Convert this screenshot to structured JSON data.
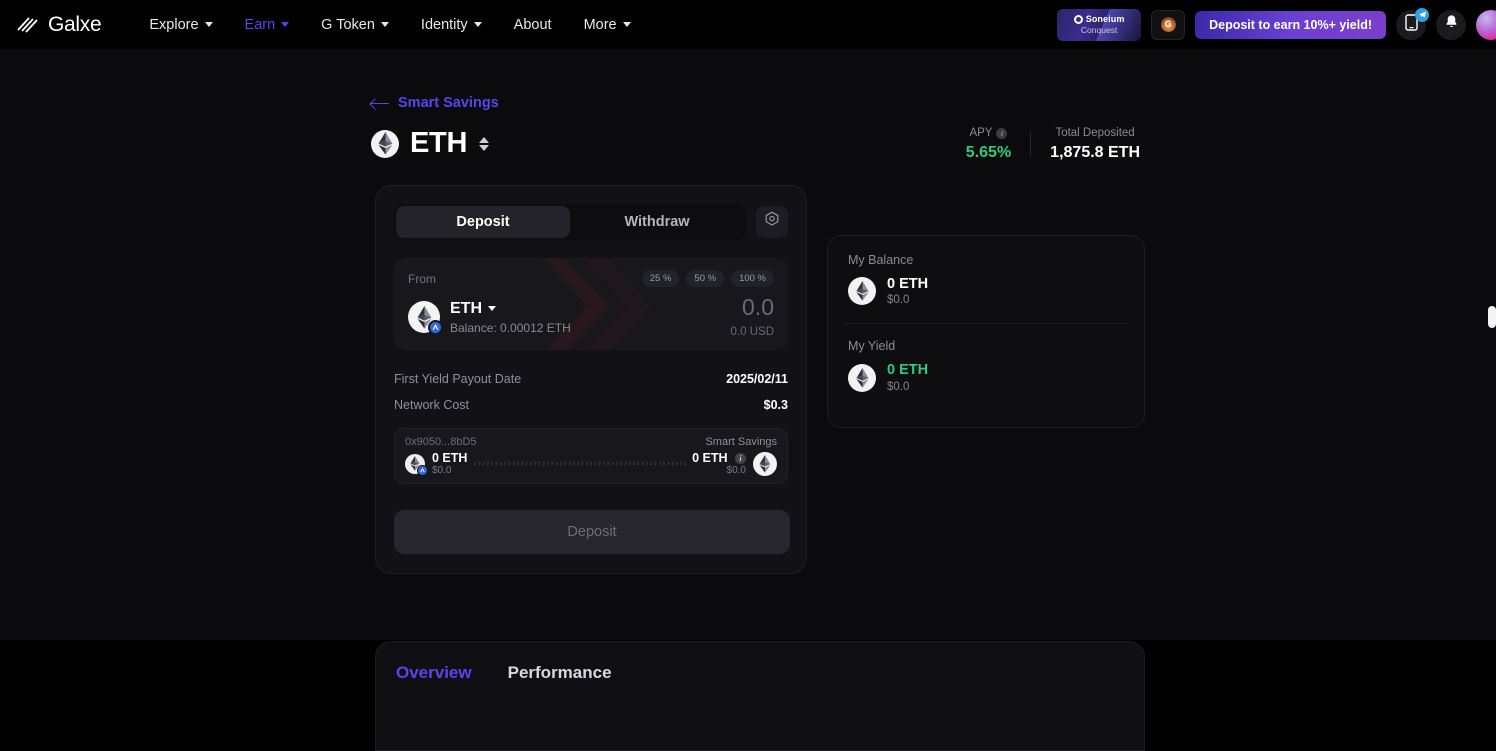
{
  "header": {
    "logo_text": "Galxe",
    "logo_icon": "galxe-logo-icon",
    "nav": [
      {
        "label": "Explore",
        "has_caret": true,
        "active": false
      },
      {
        "label": "Earn",
        "has_caret": true,
        "active": true
      },
      {
        "label": "G Token",
        "has_caret": true,
        "active": false
      },
      {
        "label": "Identity",
        "has_caret": true,
        "active": false
      },
      {
        "label": "About",
        "has_caret": false,
        "active": false
      },
      {
        "label": "More",
        "has_caret": true,
        "active": false
      }
    ],
    "soneium": {
      "title": "Soneium",
      "subtitle": "Conquest"
    },
    "chain_switch_icon": "chain-token-icon",
    "promo_label": "Deposit to earn 10%+ yield!",
    "mobile_icon": "mobile-app-icon",
    "mobile_badge_icon": "telegram-badge-icon",
    "bell_icon": "notification-bell-icon",
    "avatar_icon": "user-avatar"
  },
  "page": {
    "back_label": "Smart Savings",
    "back_icon": "arrow-left-icon",
    "asset_symbol": "ETH",
    "asset_icon": "eth-token-icon",
    "asset_switch_icon": "swap-vertical-icon",
    "stats": [
      {
        "label": "APY",
        "value": "5.65%",
        "green": true,
        "has_info": true
      },
      {
        "label": "Total Deposited",
        "value": "1,875.8 ETH",
        "green": false,
        "has_info": false
      }
    ]
  },
  "swap": {
    "tabs": [
      {
        "label": "Deposit",
        "active": true
      },
      {
        "label": "Withdraw",
        "active": false
      }
    ],
    "settings_icon": "settings-gear-icon",
    "from": {
      "label": "From",
      "percents": [
        "25 %",
        "50 %",
        "100 %"
      ],
      "token": "ETH",
      "token_icon": "eth-token-icon",
      "chain_icon": "arbitrum-chain-icon",
      "balance": "Balance: 0.00012 ETH",
      "amount": "0.0",
      "amount_usd": "0.0 USD",
      "usd_suffix": "USD"
    },
    "details": [
      {
        "key": "First Yield Payout Date",
        "value": "2025/02/11"
      },
      {
        "key": "Network Cost",
        "value": "$0.3"
      }
    ],
    "route": {
      "from_address": "0x9050...8bD5",
      "to_label": "Smart Savings",
      "from_amount": "0 ETH",
      "from_usd": "$0.0",
      "to_amount": "0 ETH",
      "to_usd": "$0.0",
      "dots": "››››››››››››››››››››››››››››››››››››››››››››››››››",
      "from_icon": "eth-token-icon",
      "from_chain_icon": "arbitrum-chain-icon",
      "to_icon": "eth-token-icon",
      "info_icon": "info-icon"
    },
    "submit_label": "Deposit"
  },
  "side": {
    "balance": {
      "label": "My Balance",
      "amount": "0 ETH",
      "usd": "$0.0",
      "icon": "eth-token-icon"
    },
    "yield": {
      "label": "My Yield",
      "amount": "0 ETH",
      "usd": "$0.0",
      "icon": "eth-token-icon"
    }
  },
  "bottom": {
    "tabs": [
      {
        "label": "Overview",
        "active": true
      },
      {
        "label": "Performance",
        "active": false
      }
    ]
  },
  "colors": {
    "accent": "#5b43f0",
    "green": "#2ecb83",
    "page_bg": "#0b0b0d",
    "card_bg": "#121216"
  }
}
